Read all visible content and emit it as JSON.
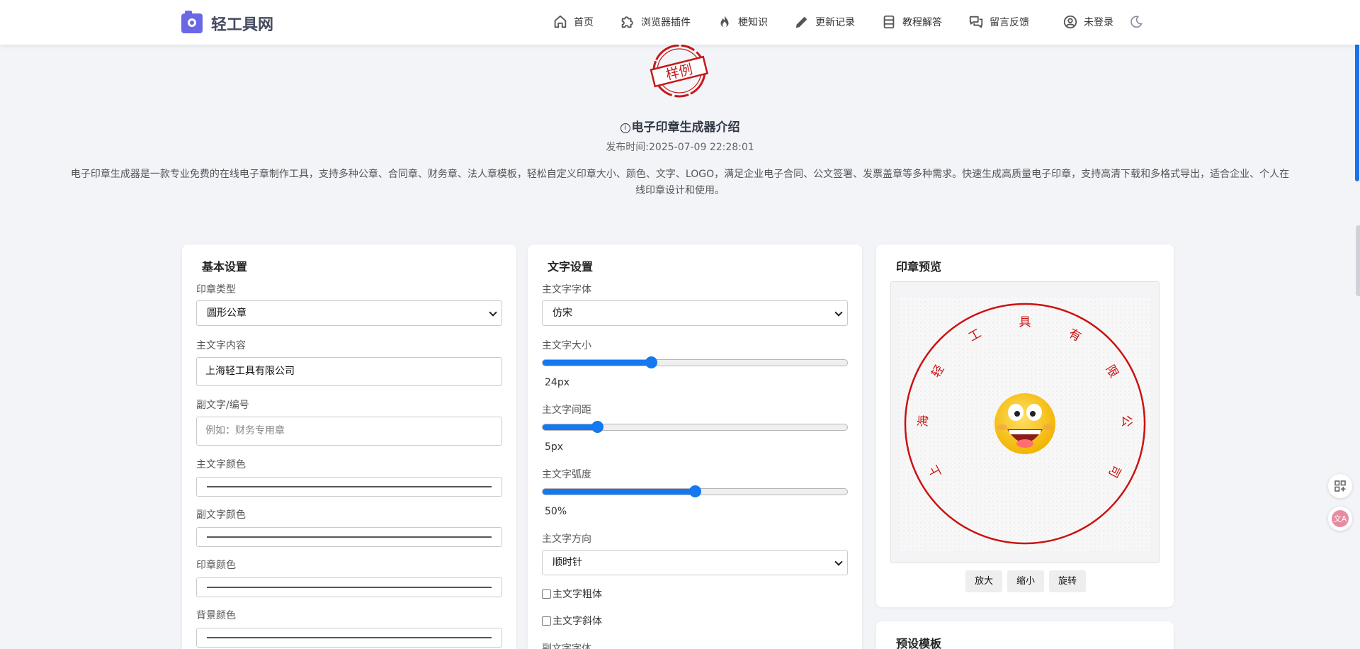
{
  "brand": {
    "name": "轻工具网",
    "accent": "#6b68e6"
  },
  "nav": {
    "items": [
      {
        "label": "首页",
        "icon": "home-icon"
      },
      {
        "label": "浏览器插件",
        "icon": "puzzle-icon"
      },
      {
        "label": "梗知识",
        "icon": "fire-icon"
      },
      {
        "label": "更新记录",
        "icon": "pencil-icon"
      },
      {
        "label": "教程解答",
        "icon": "list-icon"
      },
      {
        "label": "留言反馈",
        "icon": "chat-icon"
      }
    ],
    "user_label": "未登录",
    "theme_icon": "moon-icon"
  },
  "hero": {
    "sample_text": "样例",
    "title": "电子印章生成器介绍",
    "publish_time": "发布时间:2025-07-09 22:28:01",
    "description": "电子印章生成器是一款专业免费的在线电子章制作工具，支持多种公章、合同章、财务章、法人章模板，轻松自定义印章大小、颜色、文字、LOGO，满足企业电子合同、公文签署、发票盖章等多种需求。快速生成高质量电子印章，支持高清下载和多格式导出，适合企业、个人在线印章设计和使用。"
  },
  "basic": {
    "title": "基本设置",
    "stamp_type_label": "印章类型",
    "stamp_type_value": "圆形公章",
    "main_text_label": "主文字内容",
    "main_text_value": "上海轻工具有限公司",
    "sub_text_label": "副文字/编号",
    "sub_text_placeholder": "例如：财务专用章",
    "main_color_label": "主文字颜色",
    "sub_color_label": "副文字颜色",
    "stamp_color_label": "印章颜色",
    "bg_color_label": "背景颜色"
  },
  "text_settings": {
    "title": "文字设置",
    "font_label": "主文字字体",
    "font_value": "仿宋",
    "size_label": "主文字大小",
    "size_value": "24px",
    "size_fraction": 0.355,
    "spacing_label": "主文字间距",
    "spacing_value": "5px",
    "spacing_fraction": 0.18,
    "arc_label": "主文字弧度",
    "arc_value": "50%",
    "arc_fraction": 0.5,
    "direction_label": "主文字方向",
    "direction_value": "顺时针",
    "bold_label": "主文字粗体",
    "italic_label": "主文字斜体",
    "sub_font_label": "副文字字体"
  },
  "preview": {
    "title": "印章预览",
    "stamp_text": "上海轻工具有限公司",
    "stamp_color": "#cc1111",
    "zoom_in": "放大",
    "zoom_out": "缩小",
    "rotate": "旋转"
  },
  "templates": {
    "title": "预设模板"
  }
}
